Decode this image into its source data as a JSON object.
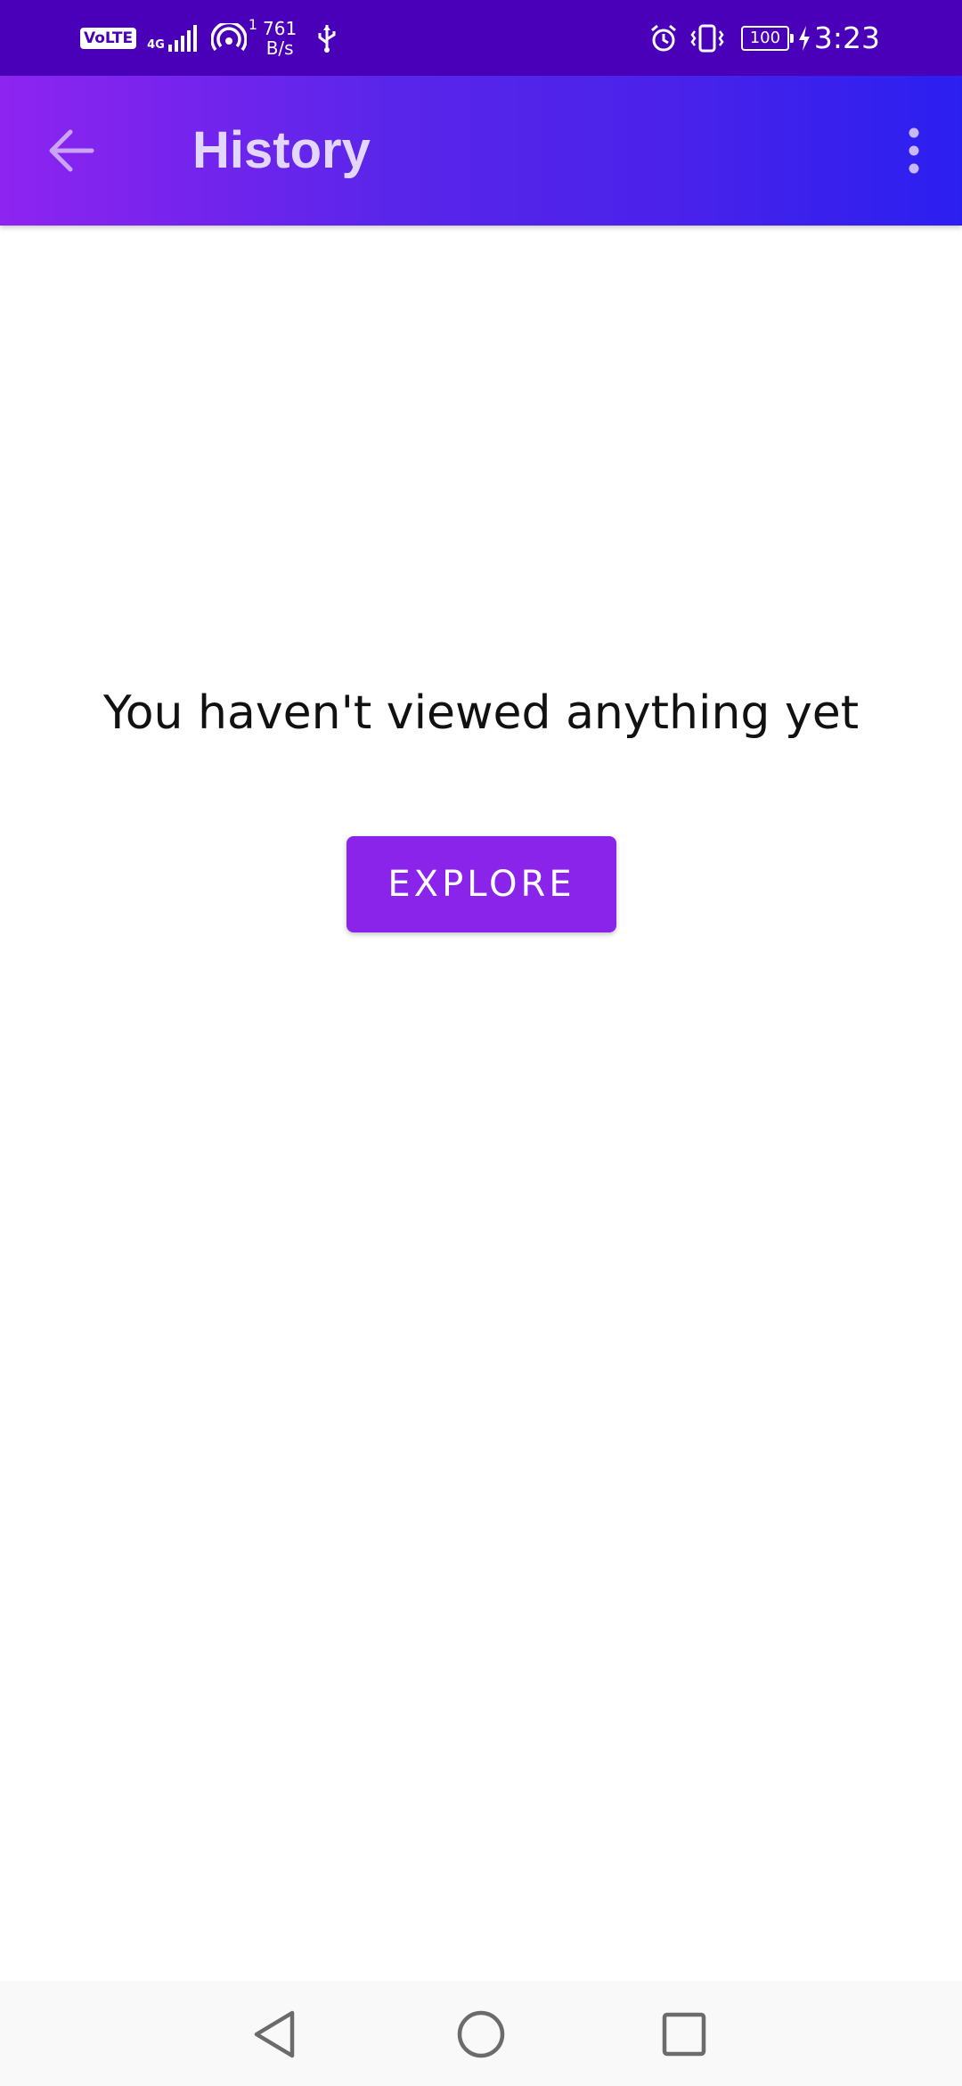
{
  "status_bar": {
    "network_badge": "VoLTE",
    "network_type": "4G",
    "hotspot_count": "1",
    "speed_value": "761",
    "speed_unit": "B/s",
    "battery_level": "100",
    "time": "3:23"
  },
  "app_bar": {
    "title": "History",
    "back_icon": "arrow-back-icon",
    "more_icon": "more-vert-icon"
  },
  "main": {
    "empty_message": "You haven't viewed anything yet",
    "explore_label": "EXPLORE"
  },
  "nav_bar": {
    "back_icon": "triangle-back-icon",
    "home_icon": "circle-home-icon",
    "recents_icon": "square-recents-icon"
  },
  "colors": {
    "status_bar": "#4a00b8",
    "app_bar_start": "#8e24f0",
    "app_bar_end": "#2b1ff0",
    "accent_button": "#8a24ea",
    "title_text": "#e3d6ff"
  }
}
